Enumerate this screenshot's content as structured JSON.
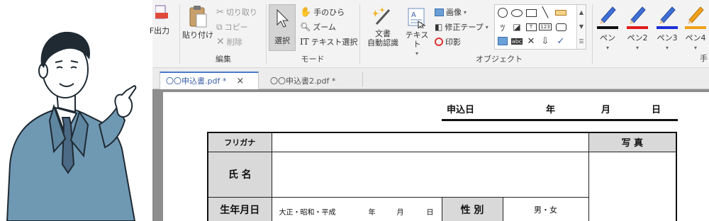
{
  "ribbon": {
    "output_label": "F出力",
    "paste_label": "貼り付け",
    "cut_label": "切り取り",
    "copy_label": "コピー",
    "delete_label": "削除",
    "edit_group": "編集",
    "select_label": "選択",
    "hand_label": "手のひら",
    "zoom_label": "ズーム",
    "textselect_label": "テキスト選択",
    "mode_group": "モード",
    "ocr_label_1": "文書",
    "ocr_label_2": "自動認識",
    "text_label": "テキスト",
    "image_label": "画像",
    "tape_label": "修正テープ",
    "stamp_label": "印影",
    "object_group": "オブジェクト",
    "gallery_abc": "abc",
    "gallery_123": "123",
    "pens": [
      {
        "label": "ペン",
        "color": "#111111"
      },
      {
        "label": "ペン2",
        "color": "#e01b1b"
      },
      {
        "label": "ペン3",
        "color": "#1a2fd6"
      },
      {
        "label": "ペン4",
        "color": "#f1a21a"
      }
    ],
    "pen_group_partial": "手"
  },
  "tabs": [
    {
      "label": "〇〇申込書.pdf *",
      "close": "×"
    },
    {
      "label": "〇〇申込書2.pdf *"
    }
  ],
  "document": {
    "date_label": "申込日",
    "year_label": "年",
    "month_label": "月",
    "day_label": "日",
    "furigana_label": "フリガナ",
    "photo_label": "写 真",
    "name_label": "氏 名",
    "birth_label": "生年月日",
    "era_text": "大正・昭和・平成",
    "birth_year": "年",
    "birth_month": "月",
    "birth_day": "日",
    "gender_label": "性 別",
    "gender_options": "男・女"
  },
  "colors": {
    "accent": "#4a78c8",
    "suit": "#6f98b3",
    "shirt_tie": "#5e7f9b"
  }
}
